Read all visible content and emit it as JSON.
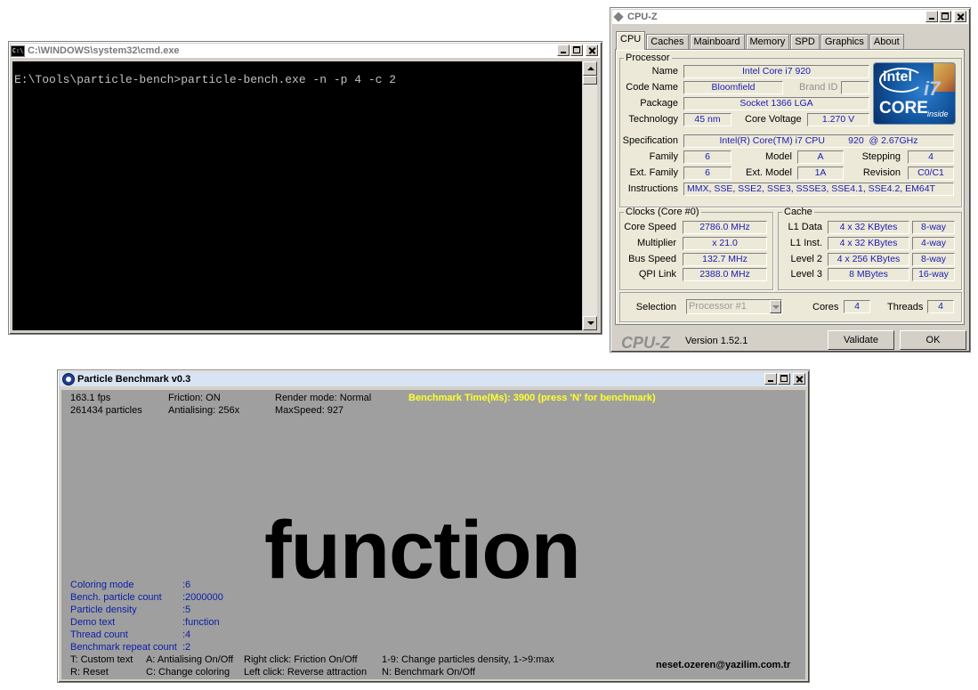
{
  "cmd": {
    "title": "C:\\WINDOWS\\system32\\cmd.exe",
    "icon_text": "C:\\",
    "prompt_line": "E:\\Tools\\particle-bench>particle-bench.exe -n -p 4 -c 2"
  },
  "cpuz": {
    "title": "CPU-Z",
    "tabs": [
      "CPU",
      "Caches",
      "Mainboard",
      "Memory",
      "SPD",
      "Graphics",
      "About"
    ],
    "processor": {
      "legend": "Processor",
      "name_label": "Name",
      "name": "Intel Core i7 920",
      "codename_label": "Code Name",
      "codename": "Bloomfield",
      "brandid_label": "Brand ID",
      "brandid": "",
      "package_label": "Package",
      "package": "Socket 1366 LGA",
      "technology_label": "Technology",
      "technology": "45 nm",
      "voltage_label": "Core Voltage",
      "voltage": "1.270 V",
      "spec_label": "Specification",
      "spec": "Intel(R) Core(TM) i7 CPU         920  @ 2.67GHz",
      "family_label": "Family",
      "family": "6",
      "model_label": "Model",
      "model": "A",
      "stepping_label": "Stepping",
      "stepping": "4",
      "extfamily_label": "Ext. Family",
      "extfamily": "6",
      "extmodel_label": "Ext. Model",
      "extmodel": "1A",
      "revision_label": "Revision",
      "revision": "C0/C1",
      "instructions_label": "Instructions",
      "instructions": "MMX, SSE, SSE2, SSE3, SSSE3, SSE4.1, SSE4.2, EM64T"
    },
    "logo": {
      "word": "intel",
      "core": "CORE",
      "seven": "i7",
      "inside": "inside"
    },
    "clocks": {
      "legend": "Clocks (Core #0)",
      "core_speed_label": "Core Speed",
      "core_speed": "2786.0 MHz",
      "multiplier_label": "Multiplier",
      "multiplier": "x 21.0",
      "bus_speed_label": "Bus Speed",
      "bus_speed": "132.7 MHz",
      "qpi_label": "QPI Link",
      "qpi": "2388.0 MHz"
    },
    "cache": {
      "legend": "Cache",
      "l1d_label": "L1 Data",
      "l1d": "4 x 32 KBytes",
      "l1d_way": "8-way",
      "l1i_label": "L1 Inst.",
      "l1i": "4 x 32 KBytes",
      "l1i_way": "4-way",
      "l2_label": "Level 2",
      "l2": "4 x 256 KBytes",
      "l2_way": "8-way",
      "l3_label": "Level 3",
      "l3": "8 MBytes",
      "l3_way": "16-way"
    },
    "selection_label": "Selection",
    "selection": "Processor #1",
    "cores_label": "Cores",
    "cores": "4",
    "threads_label": "Threads",
    "threads": "4",
    "footer_brand": "CPU-Z",
    "version": "Version 1.52.1",
    "validate_label": "Validate",
    "ok_label": "OK"
  },
  "bench": {
    "title": "Particle Benchmark v0.3",
    "fps": "163.1 fps",
    "particles": "261434 particles",
    "friction": "Friction: ON",
    "antialias": "Antialising: 256x",
    "render_mode": "Render mode: Normal",
    "max_speed": "MaxSpeed: 927",
    "benchmark_time": "Benchmark Time(Ms): 3900 (press 'N' for benchmark)",
    "demo_word": "function",
    "settings": [
      {
        "label": "Coloring mode",
        "value": ":6"
      },
      {
        "label": "Bench. particle count",
        "value": ":2000000"
      },
      {
        "label": "Particle density",
        "value": ":5"
      },
      {
        "label": "Demo text",
        "value": ":function"
      },
      {
        "label": "Thread count",
        "value": ":4"
      },
      {
        "label": "Benchmark repeat count",
        "value": ":2"
      }
    ],
    "help": {
      "custom_text": "T: Custom text",
      "reset": "R: Reset",
      "antialias_toggle": "A: Antialising On/Off",
      "change_coloring": "C: Change coloring",
      "right_click": "Right click: Friction On/Off",
      "left_click": "Left click: Reverse attraction",
      "density_keys": "1-9: Change particles density, 1->9:max",
      "bench_toggle": "N: Benchmark On/Off"
    },
    "author": "neset.ozeren@yazilim.com.tr"
  }
}
